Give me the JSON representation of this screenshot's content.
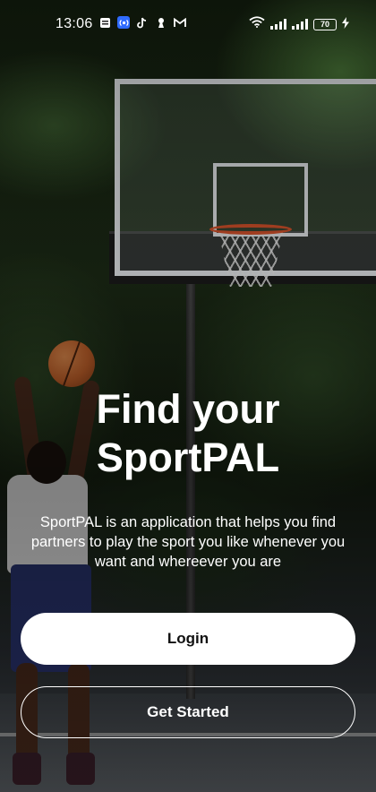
{
  "status_bar": {
    "time": "13:06",
    "notification_icons": [
      "news-icon",
      "radio-icon",
      "tiktok-icon",
      "keyhole-icon",
      "gmail-icon"
    ],
    "signal_1_label": "ııll",
    "signal_2_label": "ııll",
    "battery_level": "70",
    "charging": true
  },
  "hero": {
    "title_line1": "Find your",
    "title_line2": "SportPAL",
    "description": "SportPAL is an application that helps you find partners to play the sport you like whenever you want and whereever you are"
  },
  "actions": {
    "login_label": "Login",
    "get_started_label": "Get Started"
  },
  "colors": {
    "primary_button_bg": "#ffffff",
    "primary_button_text": "#111111",
    "secondary_button_border": "#ffffff",
    "text": "#ffffff"
  }
}
